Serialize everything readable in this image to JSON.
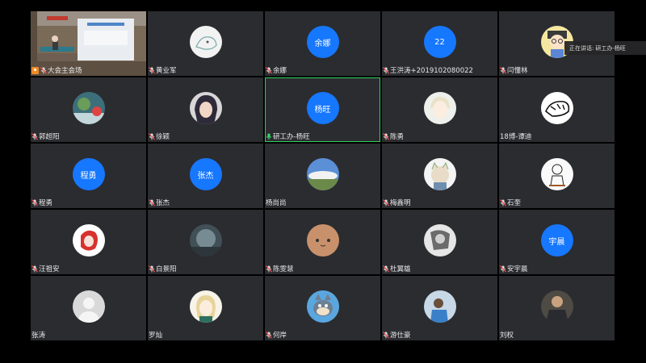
{
  "speaking": {
    "prefix": "正在讲话:",
    "name": "研工办-杨旺"
  },
  "tiles": [
    {
      "name": "大会主会场",
      "avatar": {
        "kind": "video",
        "desc": "room-video"
      },
      "mic": "muted",
      "host": true
    },
    {
      "name": "黄业军",
      "avatar": {
        "kind": "image",
        "desc": "sketch-animal"
      },
      "mic": "muted"
    },
    {
      "name": "余娜",
      "avatar": {
        "kind": "text",
        "text": "余娜"
      },
      "mic": "muted"
    },
    {
      "name": "王洪涛+2019102080022",
      "avatar": {
        "kind": "text",
        "text": "22"
      },
      "mic": "muted"
    },
    {
      "name": "闫懂林",
      "avatar": {
        "kind": "image",
        "desc": "cartoon-boy"
      },
      "mic": "muted"
    },
    {
      "name": "郭超阳",
      "avatar": {
        "kind": "image",
        "desc": "landscape-photo"
      },
      "mic": "muted"
    },
    {
      "name": "徐颖",
      "avatar": {
        "kind": "image",
        "desc": "anime-portrait"
      },
      "mic": "muted"
    },
    {
      "name": "研工办-杨旺",
      "avatar": {
        "kind": "text",
        "text": "杨旺"
      },
      "mic": "active",
      "speaking": true
    },
    {
      "name": "陈勇",
      "avatar": {
        "kind": "image",
        "desc": "anime-boy"
      },
      "mic": "muted"
    },
    {
      "name": "18博-谭迪",
      "avatar": {
        "kind": "image",
        "desc": "ink-tiger"
      },
      "mic": "none"
    },
    {
      "name": "程勇",
      "avatar": {
        "kind": "text",
        "text": "程勇"
      },
      "mic": "muted"
    },
    {
      "name": "张杰",
      "avatar": {
        "kind": "text",
        "text": "张杰"
      },
      "mic": "muted"
    },
    {
      "name": "杨尚尚",
      "avatar": {
        "kind": "image",
        "desc": "sky-clouds"
      },
      "mic": "none"
    },
    {
      "name": "梅鑫明",
      "avatar": {
        "kind": "image",
        "desc": "cartoon-cat"
      },
      "mic": "muted"
    },
    {
      "name": "石奎",
      "avatar": {
        "kind": "image",
        "desc": "sketch-child"
      },
      "mic": "muted"
    },
    {
      "name": "汪祖安",
      "avatar": {
        "kind": "image",
        "desc": "anime-red"
      },
      "mic": "muted"
    },
    {
      "name": "白景阳",
      "avatar": {
        "kind": "image",
        "desc": "dark-blur"
      },
      "mic": "muted"
    },
    {
      "name": "陈雯慧",
      "avatar": {
        "kind": "image",
        "desc": "cute-face"
      },
      "mic": "muted"
    },
    {
      "name": "杜翼雄",
      "avatar": {
        "kind": "image",
        "desc": "bw-photo"
      },
      "mic": "muted"
    },
    {
      "name": "安宇晨",
      "avatar": {
        "kind": "text",
        "text": "宇晨"
      },
      "mic": "muted"
    },
    {
      "name": "张涛",
      "avatar": {
        "kind": "image",
        "desc": "default-person"
      },
      "mic": "none"
    },
    {
      "name": "罗灿",
      "avatar": {
        "kind": "image",
        "desc": "anime-blonde"
      },
      "mic": "none"
    },
    {
      "name": "何岸",
      "avatar": {
        "kind": "image",
        "desc": "cartoon-tom"
      },
      "mic": "muted"
    },
    {
      "name": "游仕豪",
      "avatar": {
        "kind": "image",
        "desc": "blue-photo"
      },
      "mic": "muted"
    },
    {
      "name": "刘权",
      "avatar": {
        "kind": "image",
        "desc": "person-photo"
      },
      "mic": "none"
    }
  ]
}
